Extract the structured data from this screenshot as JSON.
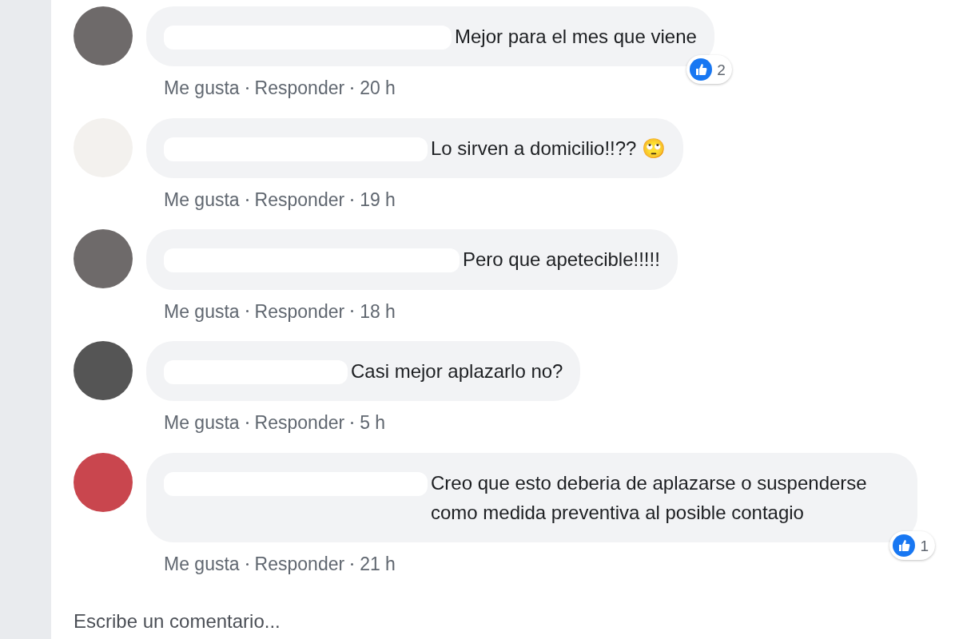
{
  "comments": [
    {
      "text": "Mejor para el mes que viene",
      "reactions": "2",
      "actions": [
        "Me gusta",
        "Responder"
      ],
      "time": "20 h"
    },
    {
      "text": "Lo sirven a domicilio!!?? 🙄",
      "actions": [
        "Me gusta",
        "Responder"
      ],
      "time": "19 h"
    },
    {
      "text": "Pero que apetecible!!!!!",
      "actions": [
        "Me gusta",
        "Responder"
      ],
      "time": "18 h"
    },
    {
      "text": "Casi mejor aplazarlo no?",
      "actions": [
        "Me gusta",
        "Responder"
      ],
      "time": "5 h"
    },
    {
      "text": "Creo que esto deberia de aplazarse o suspenderse como medida preventiva al posible contagio",
      "reactions": "1",
      "actions": [
        "Me gusta",
        "Responder"
      ],
      "time": "21 h"
    }
  ],
  "composer": {
    "placeholder": "Escribe un comentario..."
  }
}
